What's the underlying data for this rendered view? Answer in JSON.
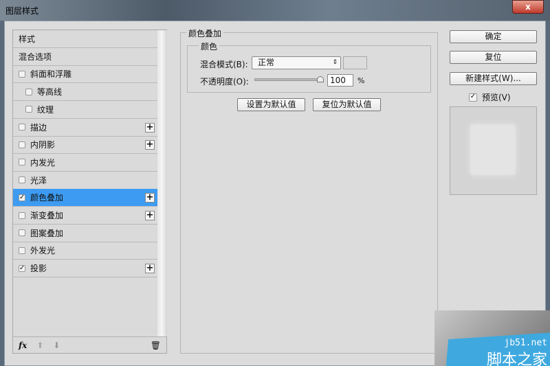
{
  "window": {
    "title": "图层样式",
    "close": "x"
  },
  "sidebar": {
    "items": [
      {
        "label": "样式",
        "checkbox": false,
        "checked": false,
        "plus": false,
        "indent": false
      },
      {
        "label": "混合选项",
        "checkbox": false,
        "checked": false,
        "plus": false,
        "indent": false
      },
      {
        "label": "斜面和浮雕",
        "checkbox": true,
        "checked": false,
        "plus": false,
        "indent": false
      },
      {
        "label": "等高线",
        "checkbox": true,
        "checked": false,
        "plus": false,
        "indent": true
      },
      {
        "label": "纹理",
        "checkbox": true,
        "checked": false,
        "plus": false,
        "indent": true
      },
      {
        "label": "描边",
        "checkbox": true,
        "checked": false,
        "plus": true,
        "indent": false
      },
      {
        "label": "内阴影",
        "checkbox": true,
        "checked": false,
        "plus": true,
        "indent": false
      },
      {
        "label": "内发光",
        "checkbox": true,
        "checked": false,
        "plus": false,
        "indent": false
      },
      {
        "label": "光泽",
        "checkbox": true,
        "checked": false,
        "plus": false,
        "indent": false
      },
      {
        "label": "颜色叠加",
        "checkbox": true,
        "checked": true,
        "plus": true,
        "indent": false,
        "selected": true
      },
      {
        "label": "渐变叠加",
        "checkbox": true,
        "checked": false,
        "plus": true,
        "indent": false
      },
      {
        "label": "图案叠加",
        "checkbox": true,
        "checked": false,
        "plus": false,
        "indent": false
      },
      {
        "label": "外发光",
        "checkbox": true,
        "checked": false,
        "plus": false,
        "indent": false
      },
      {
        "label": "投影",
        "checkbox": true,
        "checked": true,
        "plus": true,
        "indent": false
      }
    ],
    "toolbar": {
      "fx": "fx",
      "icons": [
        "fx-icon",
        "arrow-up-icon",
        "arrow-down-icon",
        "trash-icon"
      ]
    }
  },
  "panel": {
    "group_title": "颜色叠加",
    "sub_title": "颜色",
    "blend_label": "混合模式(B):",
    "blend_value": "正常",
    "opacity_label": "不透明度(O):",
    "opacity_value": "100",
    "opacity_unit": "%",
    "opacity_percent": 100,
    "set_default": "设置为默认值",
    "reset_default": "复位为默认值"
  },
  "actions": {
    "ok": "确定",
    "reset": "复位",
    "new_style": "新建样式(W)...",
    "preview_label": "预览(V)",
    "preview_checked": true
  },
  "watermark": {
    "line1": "jb51.net",
    "line2": "脚本之家"
  },
  "colors": {
    "selection": "#3d9bf2",
    "dialog": "#dcdcdc"
  }
}
